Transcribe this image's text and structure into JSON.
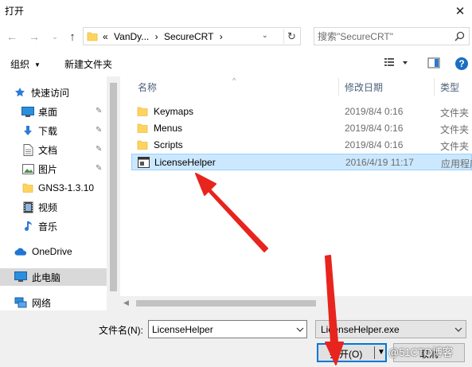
{
  "window": {
    "title": "打开",
    "close_glyph": "✕"
  },
  "address": {
    "crumbs": [
      "«",
      "VanDy...",
      "›",
      "SecureCRT",
      "›"
    ],
    "search_placeholder": "搜索\"SecureCRT\""
  },
  "toolbar": {
    "organize": "组织",
    "new_folder": "新建文件夹"
  },
  "sidebar": {
    "items": [
      {
        "label": "快速访问",
        "icon": "star-icon"
      },
      {
        "label": "桌面",
        "icon": "desktop-icon",
        "pinned": true
      },
      {
        "label": "下载",
        "icon": "download-icon",
        "pinned": true
      },
      {
        "label": "文档",
        "icon": "document-icon",
        "pinned": true
      },
      {
        "label": "图片",
        "icon": "picture-icon",
        "pinned": true
      },
      {
        "label": "GNS3-1.3.10",
        "icon": "folder-icon"
      },
      {
        "label": "视频",
        "icon": "video-icon"
      },
      {
        "label": "音乐",
        "icon": "music-icon"
      },
      {
        "label": "OneDrive",
        "icon": "cloud-icon"
      },
      {
        "label": "此电脑",
        "icon": "computer-icon",
        "selected": true
      },
      {
        "label": "网络",
        "icon": "network-icon"
      }
    ]
  },
  "filelist": {
    "columns": {
      "name": "名称",
      "date": "修改日期",
      "type": "类型"
    },
    "rows": [
      {
        "name": "Keymaps",
        "date": "2019/8/4 0:16",
        "type": "文件夹",
        "icon": "folder-icon"
      },
      {
        "name": "Menus",
        "date": "2019/8/4 0:16",
        "type": "文件夹",
        "icon": "folder-icon"
      },
      {
        "name": "Scripts",
        "date": "2019/8/4 0:16",
        "type": "文件夹",
        "icon": "folder-icon"
      },
      {
        "name": "LicenseHelper",
        "date": "2016/4/19 11:17",
        "type": "应用程序",
        "icon": "application-icon",
        "selected": true
      }
    ]
  },
  "bottom": {
    "filename_label": "文件名(N):",
    "filename_value": "LicenseHelper",
    "filetype_value": "LicenseHelper.exe",
    "open_label": "打开(O)",
    "cancel_label": "取消"
  },
  "watermark": "@51CTO博客",
  "colors": {
    "accent": "#0078d7",
    "selection": "#cce8ff",
    "annotation_arrow": "#e8241e",
    "folder": "#ffd45c"
  }
}
